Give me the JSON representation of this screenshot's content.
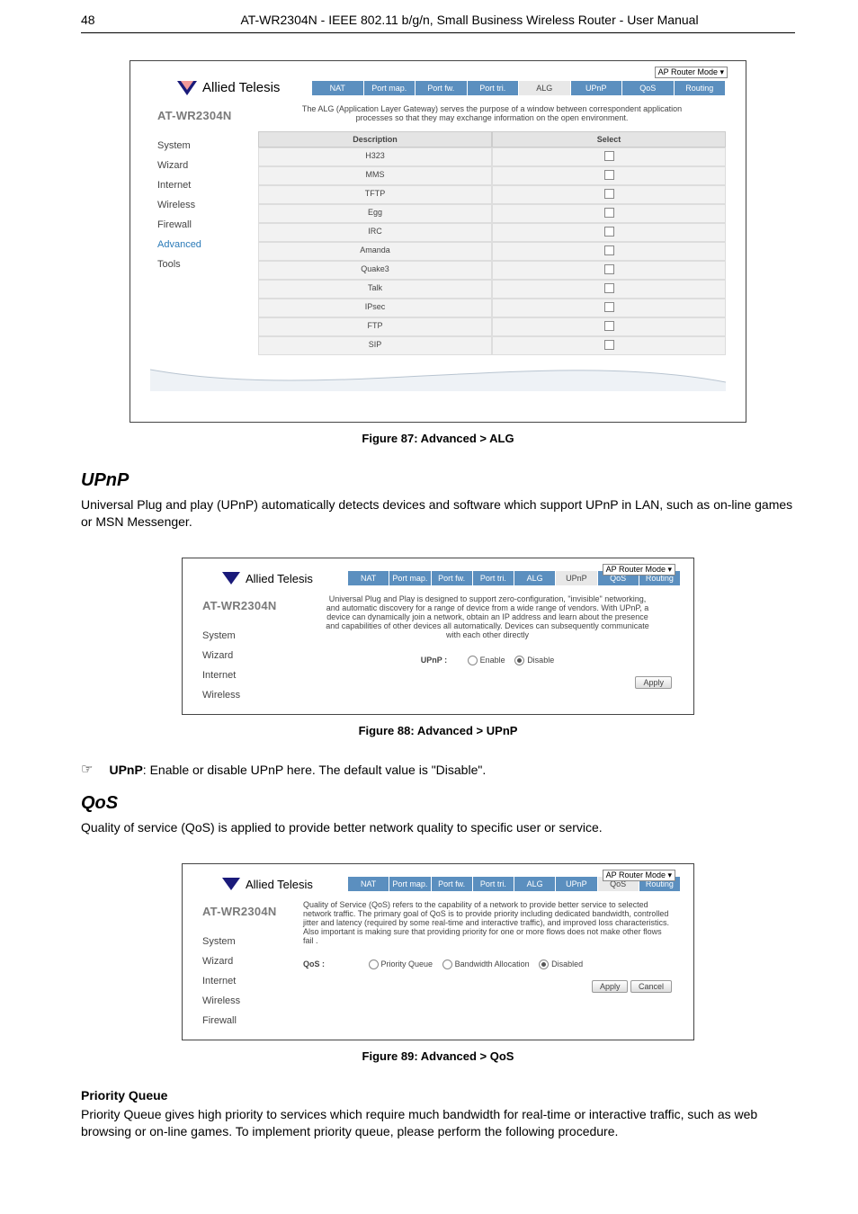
{
  "header": {
    "page_number": "48",
    "title": "AT-WR2304N - IEEE 802.11 b/g/n, Small Business Wireless Router - User Manual"
  },
  "brand": "Allied Telesis",
  "mode_label": "AP Router Mode ▾",
  "model": "AT-WR2304N",
  "tabs": [
    "NAT",
    "Port map.",
    "Port fw.",
    "Port tri.",
    "ALG",
    "UPnP",
    "QoS",
    "Routing"
  ],
  "side_items": [
    "System",
    "Wizard",
    "Internet",
    "Wireless",
    "Firewall",
    "Advanced",
    "Tools"
  ],
  "alg": {
    "intro": "The ALG (Application Layer Gateway) serves the purpose of a window between correspondent application processes so that they may exchange information on the open environment.",
    "cols": [
      "Description",
      "Select"
    ],
    "rows": [
      "H323",
      "MMS",
      "TFTP",
      "Egg",
      "IRC",
      "Amanda",
      "Quake3",
      "Talk",
      "IPsec",
      "FTP",
      "SIP"
    ]
  },
  "fig87": "Figure 87: Advanced > ALG",
  "upnp": {
    "heading": "UPnP",
    "para": "Universal Plug and play (UPnP) automatically detects devices and software which support UPnP in LAN, such as on-line games or MSN Messenger.",
    "shot_desc": "Universal Plug and Play is designed to support zero-configuration, \"invisible\" networking, and automatic discovery for a range of device from a wide range of vendors. With UPnP, a device can dynamically join a network, obtain an IP address and learn about the presence and capabilities of other devices all automatically. Devices can subsequently communicate with each other directly",
    "field_label": "UPnP :",
    "enable": "Enable",
    "disable": "Disable",
    "apply": "Apply",
    "side": [
      "System",
      "Wizard",
      "Internet",
      "Wireless"
    ]
  },
  "fig88": "Figure 88: Advanced > UPnP",
  "upnp_bullet": {
    "label": "UPnP",
    "text": ": Enable or disable UPnP here. The default value is \"Disable\"."
  },
  "qos": {
    "heading": "QoS",
    "para": "Quality of service (QoS) is applied to provide better network quality to specific user or service.",
    "shot_desc": "Quality of Service (QoS) refers to the capability of a network to provide better service to selected network traffic. The primary goal of QoS is to provide priority including dedicated bandwidth, controlled jitter and latency (required by some real-time and interactive traffic), and improved loss characteristics. Also important is making sure that providing priority for one or more flows does not make other flows fail .",
    "field_label": "QoS :",
    "opts": [
      "Priority Queue",
      "Bandwidth Allocation",
      "Disabled"
    ],
    "apply": "Apply",
    "cancel": "Cancel",
    "side": [
      "System",
      "Wizard",
      "Internet",
      "Wireless",
      "Firewall"
    ]
  },
  "fig89": "Figure 89: Advanced > QoS",
  "pq": {
    "heading": "Priority Queue",
    "para": "Priority Queue gives high priority to services which require much bandwidth for real-time or interactive traffic, such as web browsing or on-line games. To implement priority queue, please perform the following procedure."
  }
}
